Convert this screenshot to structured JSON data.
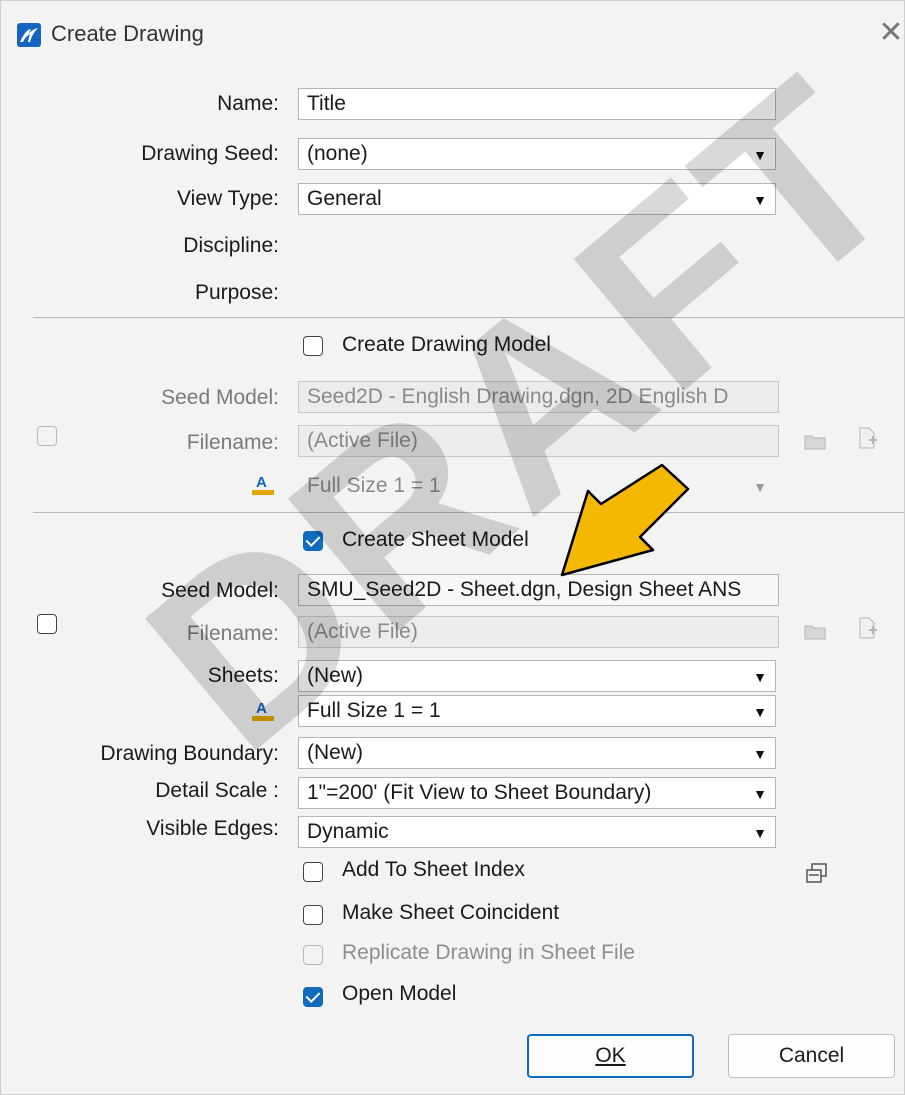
{
  "window": {
    "title": "Create Drawing",
    "close_glyph": "✕"
  },
  "form": {
    "name_label": "Name:",
    "name_value": "Title",
    "seed_label": "Drawing Seed:",
    "seed_value": "(none)",
    "viewtype_label": "View Type:",
    "viewtype_value": "General",
    "discipline_label": "Discipline:",
    "purpose_label": "Purpose:"
  },
  "drawing_model": {
    "checkbox_label": "Create Drawing Model",
    "checked": false,
    "seed_label": "Seed Model:",
    "seed_value": "Seed2D - English Drawing.dgn, 2D English D",
    "filename_label": "Filename:",
    "filename_value": "(Active File)",
    "scale_value": "Full Size 1 = 1"
  },
  "sheet_model": {
    "checkbox_label": "Create Sheet Model",
    "checked": true,
    "seed_label": "Seed Model:",
    "seed_value": "SMU_Seed2D - Sheet.dgn, Design Sheet ANS",
    "filename_label": "Filename:",
    "filename_value": "(Active File)",
    "sheets_label": "Sheets:",
    "sheets_value": "(New)",
    "scale_value": "Full Size 1 = 1",
    "boundary_label": "Drawing Boundary:",
    "boundary_value": "(New)",
    "detail_label": "Detail Scale :",
    "detail_value": "1\"=200' (Fit View to Sheet Boundary)",
    "edges_label": "Visible Edges:",
    "edges_value": "Dynamic"
  },
  "options": {
    "add_index": "Add To Sheet Index",
    "coincident": "Make Sheet Coincident",
    "replicate": "Replicate Drawing in Sheet File",
    "open_model": "Open Model"
  },
  "buttons": {
    "ok": "OK",
    "cancel": "Cancel"
  },
  "watermark": "DRAFT",
  "colors": {
    "accent": "#0f6cbd",
    "arrow": "#f5b800"
  }
}
